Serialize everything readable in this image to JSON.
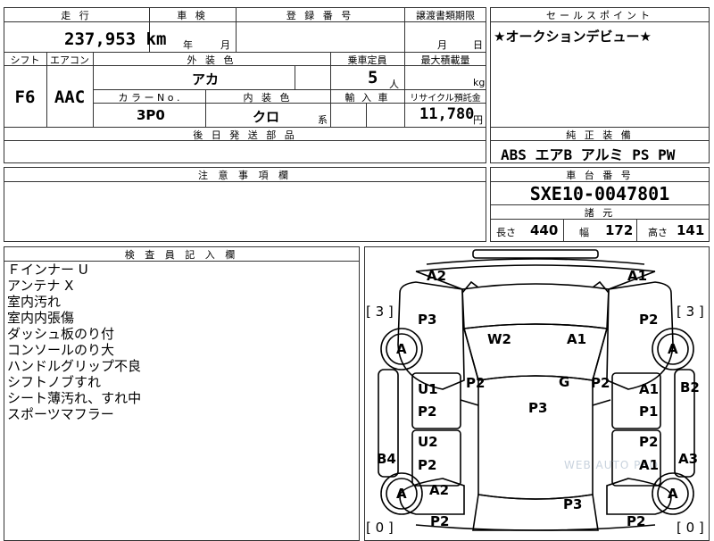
{
  "sheet": {
    "mileage": {
      "header": "走 行",
      "value": "237,953",
      "unit": "km"
    },
    "shaken": {
      "header": "車 検",
      "year_unit": "年",
      "month_unit": "月"
    },
    "registration": {
      "header": "登 録 番 号"
    },
    "transfer_docs": {
      "header": "譲渡書類期限",
      "month_unit": "月",
      "day_unit": "日"
    },
    "shift": {
      "header": "シフト",
      "value": "F6"
    },
    "aircon": {
      "header": "エアコン",
      "value": "AAC"
    },
    "exterior_color": {
      "header": "外 装 色",
      "value": "アカ"
    },
    "capacity": {
      "header": "乗車定員",
      "value": "5",
      "unit": "人"
    },
    "max_load": {
      "header": "最大積載量",
      "unit": "kg"
    },
    "color_no": {
      "header": "カ ラ ー N o .",
      "value": "3P0"
    },
    "interior_color": {
      "header": "内 装 色",
      "value": "クロ",
      "suffix": "系"
    },
    "import": {
      "header": "輸 入 車"
    },
    "recycle": {
      "header": "リサイクル預託金",
      "value": "11,780",
      "unit": "円"
    },
    "later_parts": {
      "header": "後 日 発 送 部 品"
    },
    "sales_point": {
      "header": "セールスポイント",
      "text": "★オークションデビュー★"
    },
    "equipment": {
      "header": "純 正 装 備",
      "text": "ABS エアB アルミ PS PW"
    },
    "caution": {
      "header": "注 意 事 項 欄"
    },
    "chassis": {
      "header": "車 台 番 号",
      "value": "SXE10-0047801"
    },
    "specs": {
      "header": "諸 元",
      "length_label": "長さ",
      "length": "440",
      "width_label": "幅",
      "width": "172",
      "height_label": "高さ",
      "height": "141"
    },
    "inspector": {
      "header": "検 査 員 記 入 欄",
      "notes": [
        "Ｆインナー U",
        "アンテナ X",
        "室内汚れ",
        "室内内張傷",
        "ダッシュ板のり付",
        "コンソールのり大",
        "ハンドルグリップ不良",
        "シフトノブすれ",
        "シート薄汚れ、すれ中",
        "スポーツマフラー"
      ]
    },
    "diagram": {
      "labels": [
        "A2",
        "A1",
        "[ 3 ]",
        "[ 3 ]",
        "P3",
        "P2",
        "A",
        "A",
        "W2",
        "A1",
        "U1",
        "P2",
        "G",
        "P2",
        "A1",
        "B2",
        "P2",
        "P3",
        "P1",
        "U2",
        "P2",
        "B4",
        "P2",
        "A1",
        "A3",
        "A",
        "A2",
        "A",
        "P3",
        "[ 0 ]",
        "P2",
        "P2",
        "[ 0 ]"
      ],
      "watermark": "WEB AUTO PRO"
    }
  }
}
